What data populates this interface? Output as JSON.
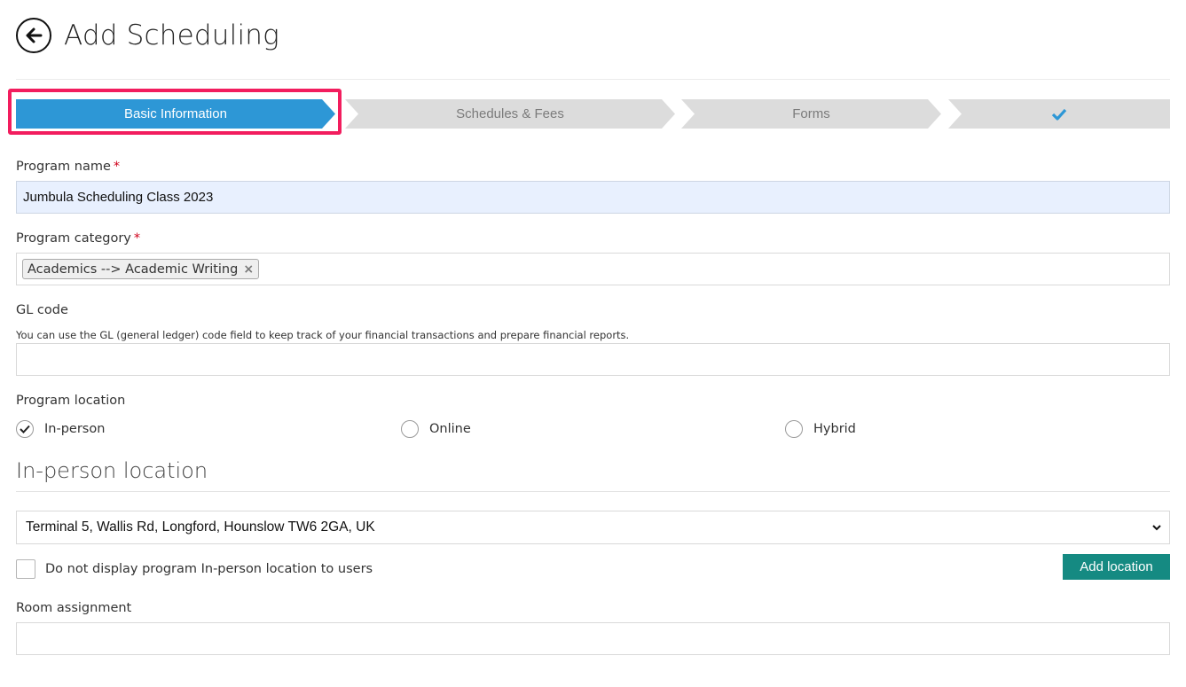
{
  "header": {
    "title": "Add Scheduling"
  },
  "wizard": {
    "steps": [
      {
        "label": "Basic Information",
        "state": "active"
      },
      {
        "label": "Schedules & Fees",
        "state": "inactive"
      },
      {
        "label": "Forms",
        "state": "inactive"
      },
      {
        "label": "",
        "icon": "checkmark-icon",
        "state": "inactive"
      }
    ],
    "active_color": "#2d97d6",
    "inactive_color": "#dcdcdc",
    "highlight_color": "#f21d5e"
  },
  "form": {
    "program_name": {
      "label": "Program name",
      "required_mark": "*",
      "value": "Jumbula Scheduling Class 2023"
    },
    "program_category": {
      "label": "Program category",
      "required_mark": "*",
      "selected_tag": "Academics --> Academic Writing",
      "remove_icon": "×"
    },
    "gl_code": {
      "label": "GL code",
      "help": "You can use the GL (general ledger) code field to keep track of your financial transactions and prepare financial reports.",
      "value": ""
    },
    "program_location": {
      "label": "Program location",
      "options": [
        {
          "label": "In-person",
          "checked": true
        },
        {
          "label": "Online",
          "checked": false
        },
        {
          "label": "Hybrid",
          "checked": false
        }
      ]
    },
    "in_person_section": {
      "title": "In-person location",
      "location_value": "Terminal 5, Wallis Rd, Longford, Hounslow TW6 2GA, UK",
      "hide_checkbox_label": "Do not display program In-person location to users",
      "hide_checkbox_checked": false,
      "add_location_label": "Add location",
      "add_location_color": "#158a82"
    },
    "room_assignment": {
      "label": "Room assignment",
      "value": ""
    }
  }
}
